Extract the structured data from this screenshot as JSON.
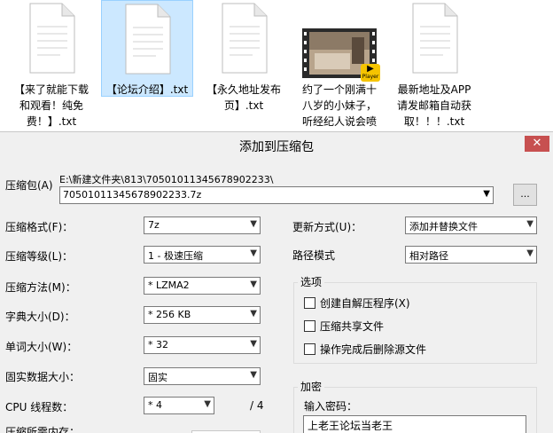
{
  "explorer": {
    "files": [
      {
        "label": "【来了就能下载\n和观看！纯免\n费！】.txt",
        "selected": false
      },
      {
        "label": "【论坛介绍】.txt",
        "selected": true
      },
      {
        "label": "【永久地址发布\n页】.txt",
        "selected": false
      },
      {
        "label": "约了一个刚满十\n八岁的小妹子，\n听经纪人说会喷\n水...",
        "selected": false,
        "video": true,
        "play_badge": "Player"
      },
      {
        "label": "最新地址及APP\n请发邮箱自动获\n取！！！.txt",
        "selected": false
      }
    ]
  },
  "dialog": {
    "title": "添加到压缩包",
    "close_label": "✕",
    "archive": {
      "label": "压缩包(A)",
      "path": "E:\\新建文件夹\\813\\70501011345678902233\\",
      "name": "70501011345678902233.7z",
      "browse_label": "..."
    },
    "left": {
      "format": {
        "label": "压缩格式(F)：",
        "value": "7z"
      },
      "level": {
        "label": "压缩等级(L)：",
        "value": "1 - 极速压缩"
      },
      "method": {
        "label": "压缩方法(M)：",
        "value": "* LZMA2"
      },
      "dict": {
        "label": "字典大小(D)：",
        "value": "* 256 KB"
      },
      "word": {
        "label": "单词大小(W)：",
        "value": "* 32"
      },
      "solid": {
        "label": "固实数据大小：",
        "value": "固实"
      },
      "cpu": {
        "label": "CPU 线程数：",
        "value": "* 4",
        "total": "/ 4"
      },
      "memory": {
        "label": "压缩所需内存："
      }
    },
    "right": {
      "update": {
        "label": "更新方式(U)：",
        "value": "添加并替换文件"
      },
      "pathmode": {
        "label": "路径模式",
        "value": "相对路径"
      },
      "options": {
        "title": "选项",
        "items": [
          "创建自解压程序(X)",
          "压缩共享文件",
          "操作完成后删除源文件"
        ]
      },
      "encryption": {
        "title": "加密",
        "password_label": "输入密码：",
        "password_value": "上老王论坛当老王"
      }
    }
  }
}
